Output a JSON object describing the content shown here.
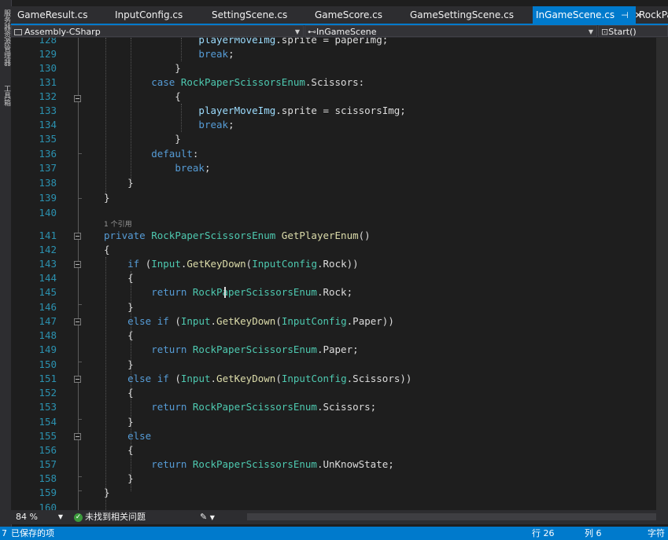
{
  "side_panel": {
    "labels": [
      "服务器资源管理器",
      "工具箱"
    ]
  },
  "tabs": [
    {
      "label": "GameResult.cs"
    },
    {
      "label": "InputConfig.cs"
    },
    {
      "label": "SettingScene.cs"
    },
    {
      "label": "GameScore.cs"
    },
    {
      "label": "GameSettingScene.cs"
    },
    {
      "label": "InGameScene.cs",
      "active": true,
      "pin_glyph": "⊣",
      "close_glyph": "✕"
    },
    {
      "label": "RockPa"
    }
  ],
  "navbar": {
    "project": "Assembly-CSharp",
    "class": "InGameScene",
    "member": "Start()"
  },
  "code": {
    "line_numbers": [
      "128",
      "129",
      "130",
      "131",
      "132",
      "133",
      "134",
      "135",
      "136",
      "137",
      "138",
      "139",
      "140",
      "141",
      "142",
      "143",
      "144",
      "145",
      "146",
      "147",
      "148",
      "149",
      "150",
      "151",
      "152",
      "153",
      "154",
      "155",
      "156",
      "157",
      "158",
      "159",
      "160"
    ],
    "reference_hint": "1 个引用"
  },
  "bottom_bar": {
    "zoom": "84 %",
    "issues": "未找到相关问题",
    "brush": "✎"
  },
  "status_bar": {
    "left_fragment": "7",
    "saved": "已保存的项",
    "line": "行 26",
    "col": "列 6",
    "char": "字符"
  },
  "colors": {
    "keyword": "#569cd6",
    "type": "#4ec9b0",
    "method": "#dcdcaa",
    "member": "#9cdcfe",
    "text": "#dcdcdc",
    "line_number": "#2b91af",
    "accent": "#007acc"
  }
}
